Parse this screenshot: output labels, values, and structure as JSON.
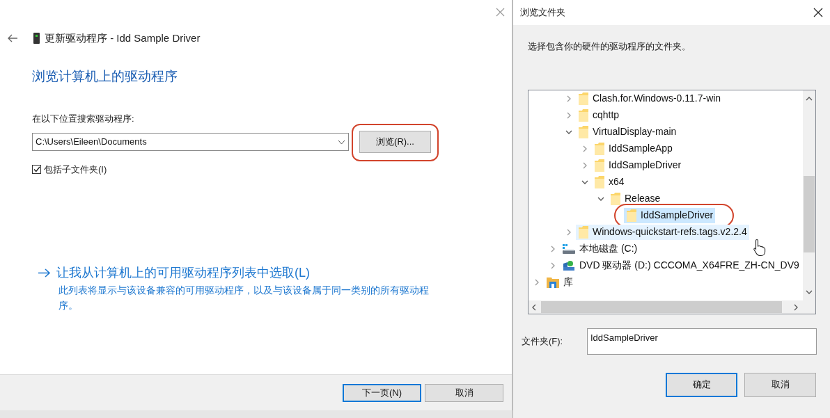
{
  "wizard": {
    "title": "更新驱动程序 - Idd Sample Driver",
    "heading": "浏览计算机上的驱动程序",
    "search_label": "在以下位置搜索驱动程序:",
    "path": "C:\\Users\\Eileen\\Documents",
    "browse_button": {
      "label": "浏览(R)...",
      "annotated": true
    },
    "include_subfolders": {
      "label": "包括子文件夹(I)",
      "checked": true
    },
    "pick_link": {
      "label": "让我从计算机上的可用驱动程序列表中选取(L)",
      "description": "此列表将显示与该设备兼容的可用驱动程序，以及与该设备属于同一类别的所有驱动程序。"
    },
    "buttons": [
      {
        "label": "下一页(N)",
        "default": true
      },
      {
        "label": "取消",
        "default": false
      }
    ]
  },
  "browse_dialog": {
    "title": "浏览文件夹",
    "description": "选择包含你的硬件的驱动程序的文件夹。",
    "tree": [
      {
        "children": [
          {
            "children": [
              {
                "label": "Clash.for.Windows-0.11.7-win",
                "kind": "folder",
                "expanded": false,
                "selected": false,
                "hovered": false
              },
              {
                "label": "cqhttp",
                "kind": "folder",
                "expanded": false,
                "selected": false,
                "hovered": false
              },
              {
                "label": "VirtualDisplay-main",
                "kind": "folder",
                "expanded": true,
                "selected": false,
                "hovered": false,
                "children": [
                  {
                    "label": "IddSampleApp",
                    "kind": "folder",
                    "expanded": false,
                    "selected": false,
                    "hovered": false
                  },
                  {
                    "label": "IddSampleDriver",
                    "kind": "folder",
                    "expanded": false,
                    "selected": false,
                    "hovered": false
                  },
                  {
                    "label": "x64",
                    "kind": "folder",
                    "expanded": true,
                    "selected": false,
                    "hovered": false,
                    "children": [
                      {
                        "label": "Release",
                        "kind": "folder",
                        "expanded": true,
                        "selected": false,
                        "hovered": false,
                        "children": [
                          {
                            "label": "IddSampleDriver",
                            "kind": "folder",
                            "selected": true,
                            "annotated": true
                          }
                        ]
                      }
                    ]
                  }
                ]
              },
              {
                "label": "Windows-quickstart-refs.tags.v2.2.4",
                "kind": "folder",
                "expanded": false,
                "selected": false,
                "hovered": true
              }
            ]
          },
          {
            "label": "本地磁盘 (C:)",
            "kind": "drive",
            "expanded": false,
            "selected": false,
            "hovered": false
          },
          {
            "label": "DVD 驱动器 (D:) CCCOMA_X64FRE_ZH-CN_DV9",
            "kind": "dvd",
            "expanded": false,
            "selected": false,
            "hovered": false
          }
        ]
      },
      {
        "label": "库",
        "kind": "library",
        "expanded": false,
        "selected": false,
        "hovered": false
      }
    ],
    "folder_label": "文件夹(F):",
    "folder_value": "IddSampleDriver",
    "buttons": [
      {
        "label": "确定",
        "default": true
      },
      {
        "label": "取消",
        "default": false
      }
    ]
  }
}
